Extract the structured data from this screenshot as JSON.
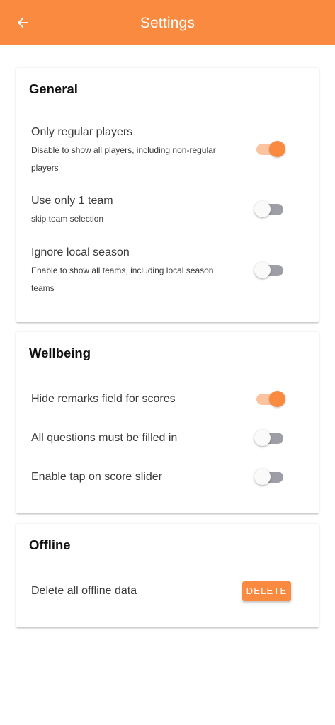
{
  "app_bar": {
    "title": "Settings",
    "back_icon": "arrow-left-icon",
    "color": "#fa8a40"
  },
  "colors": {
    "accent": "#fa8a40",
    "switch_on_track": "#fcc3a0",
    "switch_off_track": "#9e9ea6"
  },
  "general": {
    "title": "General",
    "items": [
      {
        "label": "Only regular players",
        "description": "Disable to show all players, including non-regular players",
        "enabled": true
      },
      {
        "label": "Use only 1 team",
        "description": "skip team selection",
        "enabled": false
      },
      {
        "label": "Ignore local season",
        "description": "Enable to show all teams, including local season teams",
        "enabled": false
      }
    ]
  },
  "wellbeing": {
    "title": "Wellbeing",
    "items": [
      {
        "label": "Hide remarks field for scores",
        "enabled": true
      },
      {
        "label": "All questions must be filled in",
        "enabled": false
      },
      {
        "label": "Enable tap on score slider",
        "enabled": false
      }
    ]
  },
  "offline": {
    "title": "Offline",
    "items": [
      {
        "label": "Delete all offline data",
        "button_label": "DELETE"
      }
    ]
  }
}
